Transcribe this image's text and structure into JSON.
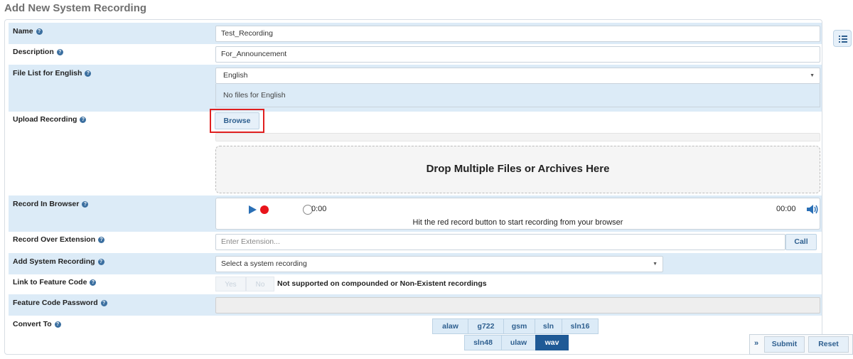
{
  "page": {
    "title": "Add New System Recording"
  },
  "fields": {
    "name": {
      "label": "Name",
      "value": "Test_Recording"
    },
    "description": {
      "label": "Description",
      "value": "For_Announcement"
    },
    "file_list": {
      "label": "File List for English",
      "selected": "English",
      "note": "No files for English"
    },
    "upload": {
      "label": "Upload Recording",
      "browse_label": "Browse",
      "dropzone_text": "Drop Multiple Files or Archives Here"
    },
    "record_browser": {
      "label": "Record In Browser",
      "current_time": "0:00",
      "duration": "00:00",
      "hint": "Hit the red record button to start recording from your browser"
    },
    "record_extension": {
      "label": "Record Over Extension",
      "placeholder": "Enter Extension...",
      "call_label": "Call"
    },
    "add_system_recording": {
      "label": "Add System Recording",
      "placeholder": "Select a system recording"
    },
    "feature_code": {
      "label": "Link to Feature Code",
      "yes_label": "Yes",
      "no_label": "No",
      "note": "Not supported on compounded or Non-Existent recordings"
    },
    "feature_code_password": {
      "label": "Feature Code Password",
      "value": ""
    },
    "convert_to": {
      "label": "Convert To",
      "formats_row1": [
        "alaw",
        "g722",
        "gsm",
        "sln",
        "sln16"
      ],
      "formats_row2": [
        "sln48",
        "ulaw",
        "wav"
      ],
      "active": "wav"
    }
  },
  "footer": {
    "expand_icon": "»",
    "submit_label": "Submit",
    "reset_label": "Reset"
  },
  "icons": {
    "help": "question-circle-icon",
    "sidebar_toggle": "list-icon",
    "volume": "volume-icon"
  },
  "colors": {
    "row_blue": "#dcebf7",
    "primary": "#1f5a96",
    "record_red": "#e8141b",
    "highlight_red": "#e02020"
  }
}
